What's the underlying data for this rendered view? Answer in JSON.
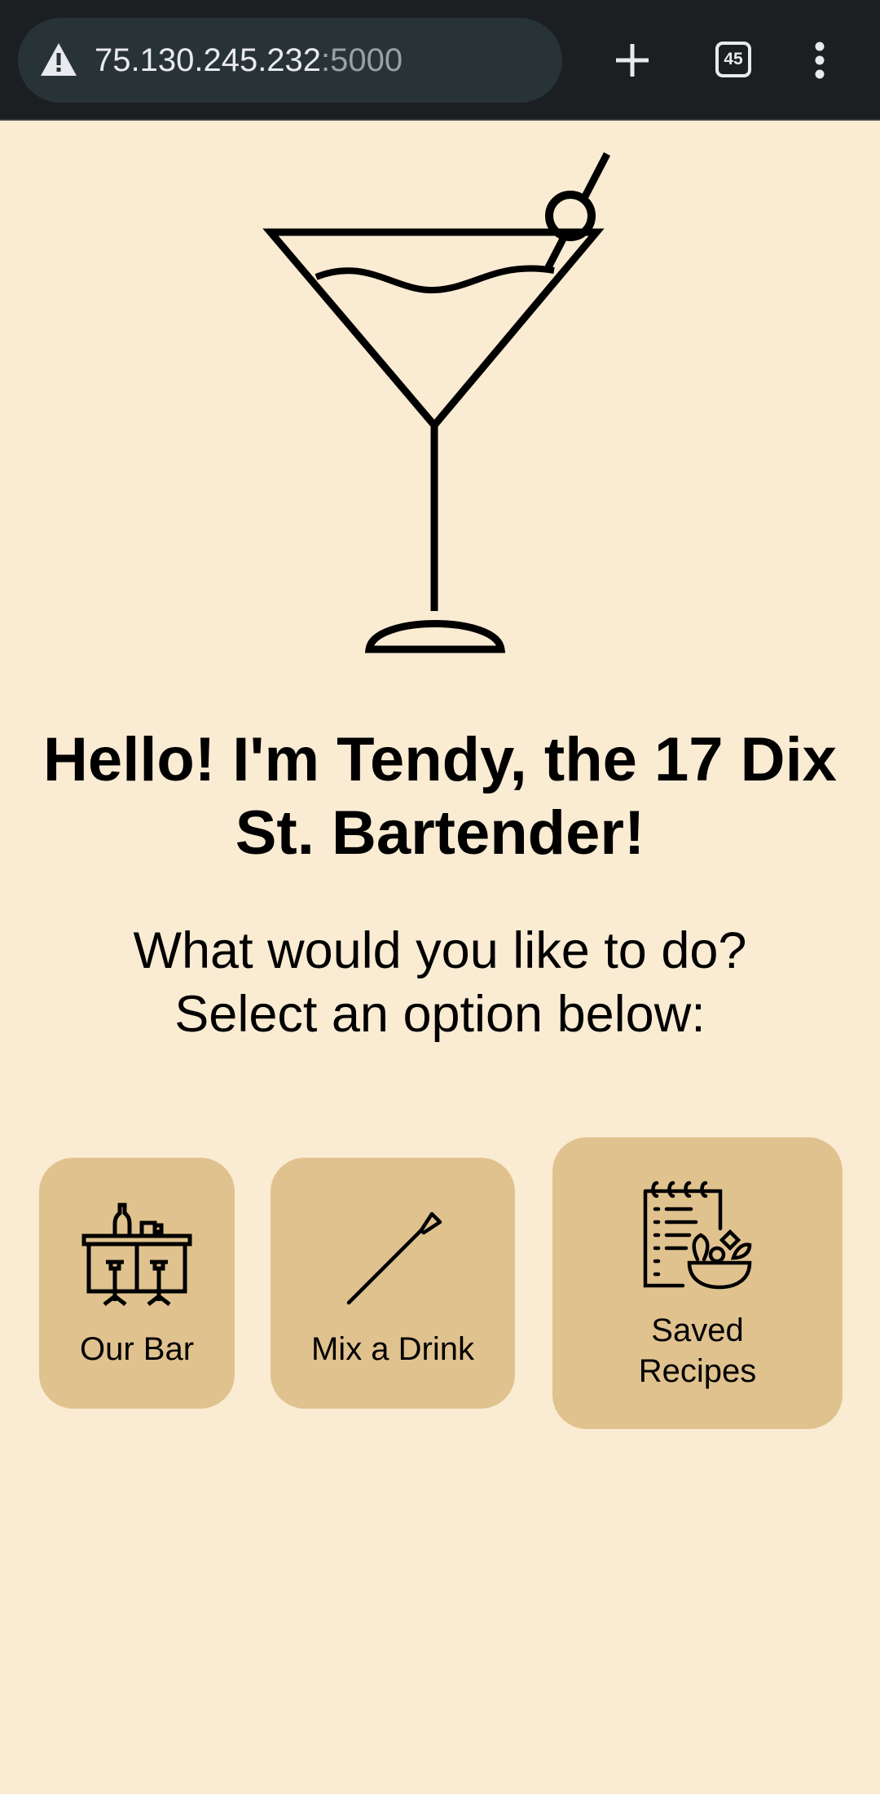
{
  "browser": {
    "url_host": "75.130.245.232",
    "url_port": ":5000",
    "tab_count": "45",
    "icons": {
      "security": "warning-triangle-icon",
      "new_tab": "plus-icon",
      "tabs": "tab-switcher-icon",
      "menu": "kebab-menu-icon"
    }
  },
  "page": {
    "hero_icon": "martini-glass-icon",
    "heading": "Hello! I'm Tendy, the 17 Dix St. Bartender!",
    "subtitle_line1": "What would you like to do?",
    "subtitle_line2": "Select an option below:",
    "options": [
      {
        "label": "Our Bar",
        "icon": "bar-counter-icon"
      },
      {
        "label": "Mix a Drink",
        "icon": "cocktail-pick-icon"
      },
      {
        "label_line1": "Saved",
        "label_line2": "Recipes",
        "icon": "recipe-notebook-icon"
      }
    ]
  },
  "colors": {
    "page_background": "#faebd3",
    "card_background": "#e0c28f",
    "browser_bar": "#1c1f22",
    "url_pill": "#283338"
  }
}
